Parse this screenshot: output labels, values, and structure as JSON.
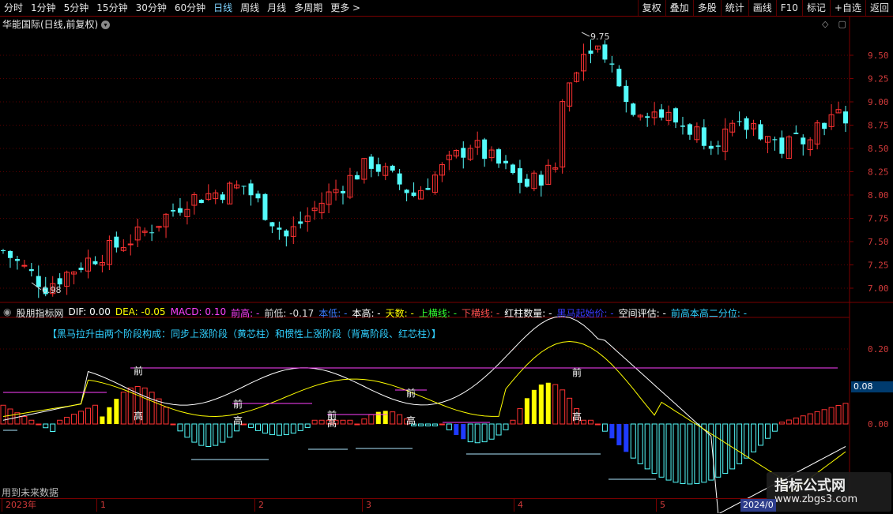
{
  "toolbar": {
    "periods": [
      "分时",
      "1分钟",
      "5分钟",
      "15分钟",
      "30分钟",
      "60分钟",
      "日线",
      "周线",
      "月线",
      "多周期",
      "更多"
    ],
    "more_arrow": ">",
    "right_buttons": [
      "复权",
      "叠加",
      "多股",
      "统计",
      "画线",
      "F10",
      "标记",
      "+自选",
      "返回"
    ]
  },
  "price_panel": {
    "title": "华能国际(日线,前复权)",
    "dropdown_icon": "chevron-down-icon",
    "high_label": "9.75",
    "low_label": "6.98",
    "y_ticks": [
      "9.50",
      "9.25",
      "9.00",
      "8.75",
      "8.50",
      "8.25",
      "8.00",
      "7.75",
      "7.50",
      "7.25",
      "7.00"
    ]
  },
  "indicator_panel": {
    "name": "股朋指标网",
    "legend": [
      {
        "text": "DIF: 0.00",
        "color": "#ffffff"
      },
      {
        "text": "DEA: -0.05",
        "color": "#ffff00"
      },
      {
        "text": "MACD: 0.10",
        "color": "#ff40ff"
      },
      {
        "text": "前高: -",
        "color": "#ff40ff"
      },
      {
        "text": "前低: -0.17",
        "color": "#dddddd"
      },
      {
        "text": "本低: -",
        "color": "#3a7bff"
      },
      {
        "text": "本高: -",
        "color": "#ffffff"
      },
      {
        "text": "天数: -",
        "color": "#ffff00"
      },
      {
        "text": "上横线: -",
        "color": "#30ff30"
      },
      {
        "text": "下横线: -",
        "color": "#ff5050"
      },
      {
        "text": "红柱数量: -",
        "color": "#ffffff"
      },
      {
        "text": "黑马起始价: -",
        "color": "#3a3aff"
      },
      {
        "text": "空间评估: -",
        "color": "#ffffff"
      },
      {
        "text": "前高本高二分位: -",
        "color": "#30d0ff"
      }
    ],
    "note": "【黑马拉升由两个阶段构成：同步上涨阶段（黄芯柱）和惯性上涨阶段（背离阶段、红芯柱）】",
    "y_ticks": [
      "0.20",
      "0.00"
    ],
    "current_value": "0.08",
    "future_data_label": "用到未来数据",
    "markers": [
      "前",
      "高",
      "前",
      "高",
      "前",
      "高",
      "前",
      "高",
      "前",
      "高"
    ]
  },
  "x_axis": {
    "labels": [
      "2023年",
      "1",
      "2",
      "3",
      "4",
      "5"
    ],
    "current_badge": "2024/0"
  },
  "watermark": {
    "title": "指标公式网",
    "url": "www.zbgs3.com"
  },
  "colors": {
    "up": "#ff3232",
    "down": "#54fcfc",
    "axis": "#7a0000",
    "dif": "#ffffff",
    "dea": "#ffff00"
  }
}
